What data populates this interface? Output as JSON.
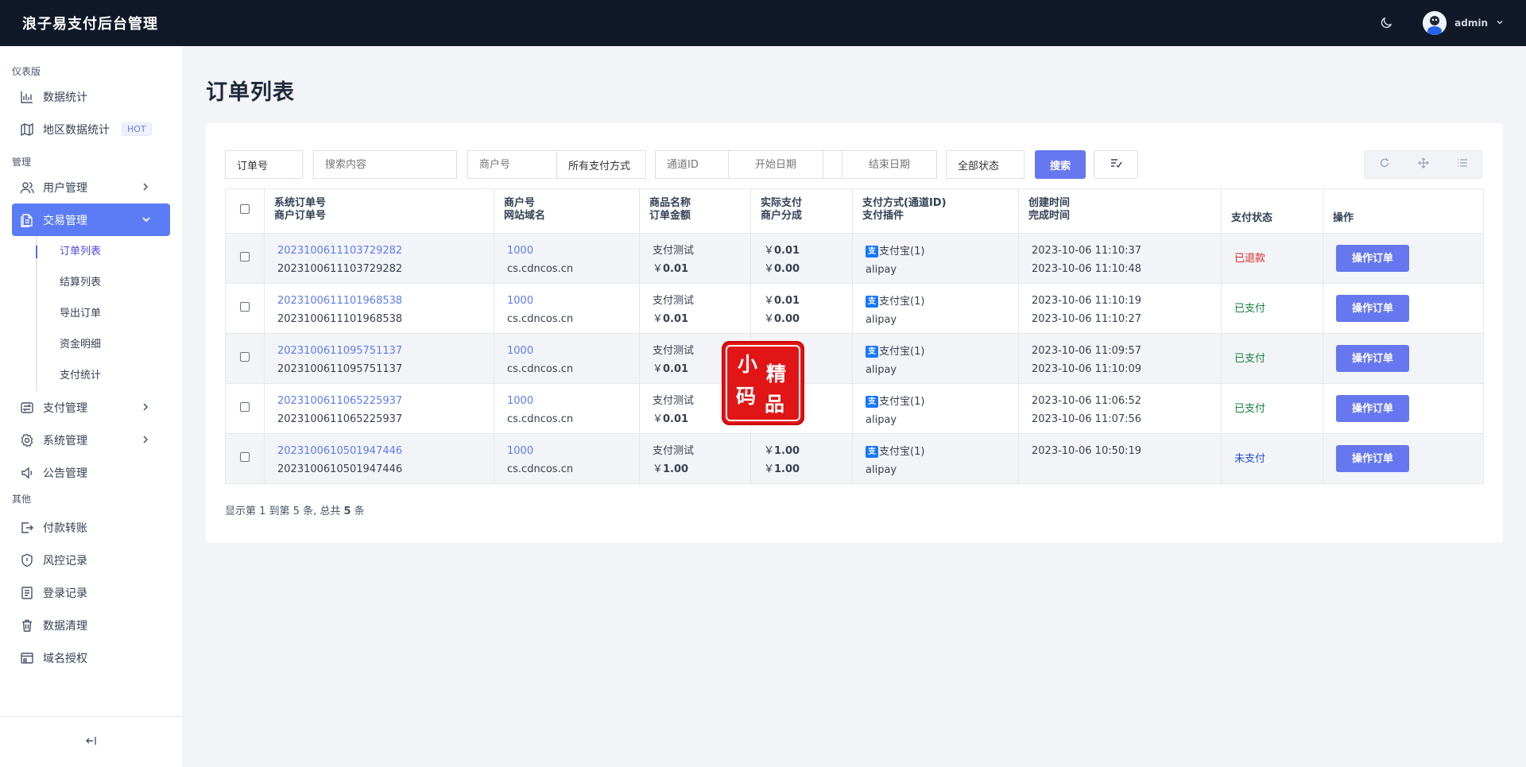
{
  "app": {
    "title": "浪子易支付后台管理",
    "user": "admin"
  },
  "sidebar": {
    "sections": {
      "dashboard": "仪表版",
      "manage": "管理",
      "other": "其他"
    },
    "items": {
      "data_stats": "数据统计",
      "region_stats": "地区数据统计",
      "hot_badge": "HOT",
      "user_mgmt": "用户管理",
      "trade_mgmt": "交易管理",
      "pay_mgmt": "支付管理",
      "sys_mgmt": "系统管理",
      "notice_mgmt": "公告管理",
      "transfer": "付款转账",
      "risk": "风控记录",
      "login_log": "登录记录",
      "data_clean": "数据清理",
      "domain_auth": "域名授权"
    },
    "trade_subs": [
      "订单列表",
      "结算列表",
      "导出订单",
      "资金明细",
      "支付统计"
    ]
  },
  "page": {
    "title": "订单列表"
  },
  "filters": {
    "order_no": "订单号",
    "search_placeholder": "搜索内容",
    "merchant_placeholder": "商户号",
    "pay_method": "所有支付方式",
    "channel_placeholder": "通道ID",
    "start_placeholder": "开始日期",
    "end_placeholder": "结束日期",
    "status": "全部状态",
    "search_btn": "搜索"
  },
  "table": {
    "headers": [
      [
        "系统订单号",
        "商户订单号"
      ],
      [
        "商户号",
        "网站域名"
      ],
      [
        "商品名称",
        "订单金额"
      ],
      [
        "实际支付",
        "商户分成"
      ],
      [
        "支付方式(通道ID)",
        "支付插件"
      ],
      [
        "创建时间",
        "完成时间"
      ],
      [
        "支付状态"
      ],
      [
        "操作"
      ]
    ],
    "currency": "￥",
    "alipay_glyph": "支",
    "op_label": "操作订单",
    "rows": [
      {
        "sys_no": "2023100611103729282",
        "mch_no": "2023100611103729282",
        "mch_id": "1000",
        "domain": "cs.cdncos.cn",
        "product": "支付测试",
        "amount": "0.01",
        "paid": "0.01",
        "share": "0.00",
        "method": "支付宝(1)",
        "plugin": "alipay",
        "created": "2023-10-06 11:10:37",
        "finished": "2023-10-06 11:10:48",
        "status": "已退款"
      },
      {
        "sys_no": "2023100611101968538",
        "mch_no": "2023100611101968538",
        "mch_id": "1000",
        "domain": "cs.cdncos.cn",
        "product": "支付测试",
        "amount": "0.01",
        "paid": "0.01",
        "share": "0.00",
        "method": "支付宝(1)",
        "plugin": "alipay",
        "created": "2023-10-06 11:10:19",
        "finished": "2023-10-06 11:10:27",
        "status": "已支付"
      },
      {
        "sys_no": "2023100611095751137",
        "mch_no": "2023100611095751137",
        "mch_id": "1000",
        "domain": "cs.cdncos.cn",
        "product": "支付测试",
        "amount": "0.01",
        "paid": "",
        "share": "",
        "method": "支付宝(1)",
        "plugin": "alipay",
        "created": "2023-10-06 11:09:57",
        "finished": "2023-10-06 11:10:09",
        "status": "已支付"
      },
      {
        "sys_no": "2023100611065225937",
        "mch_no": "2023100611065225937",
        "mch_id": "1000",
        "domain": "cs.cdncos.cn",
        "product": "支付测试",
        "amount": "0.01",
        "paid": "",
        "share": "",
        "method": "支付宝(1)",
        "plugin": "alipay",
        "created": "2023-10-06 11:06:52",
        "finished": "2023-10-06 11:07:56",
        "status": "已支付"
      },
      {
        "sys_no": "2023100610501947446",
        "mch_no": "2023100610501947446",
        "mch_id": "1000",
        "domain": "cs.cdncos.cn",
        "product": "支付测试",
        "amount": "1.00",
        "paid": "1.00",
        "share": "1.00",
        "method": "支付宝(1)",
        "plugin": "alipay",
        "created": "2023-10-06 10:50:19",
        "finished": "",
        "status": "未支付"
      }
    ]
  },
  "footer": {
    "prefix": "显示第 1 到第 5 条, 总共 ",
    "total": "5",
    "suffix": " 条"
  },
  "watermark": {
    "chars": [
      "小",
      "精",
      "码",
      "品"
    ]
  },
  "colors": {
    "accent": "#6677f0",
    "topbar": "#111827",
    "refunded": "#dc2626",
    "paid": "#15803d",
    "unpaid": "#1d4ed8"
  }
}
